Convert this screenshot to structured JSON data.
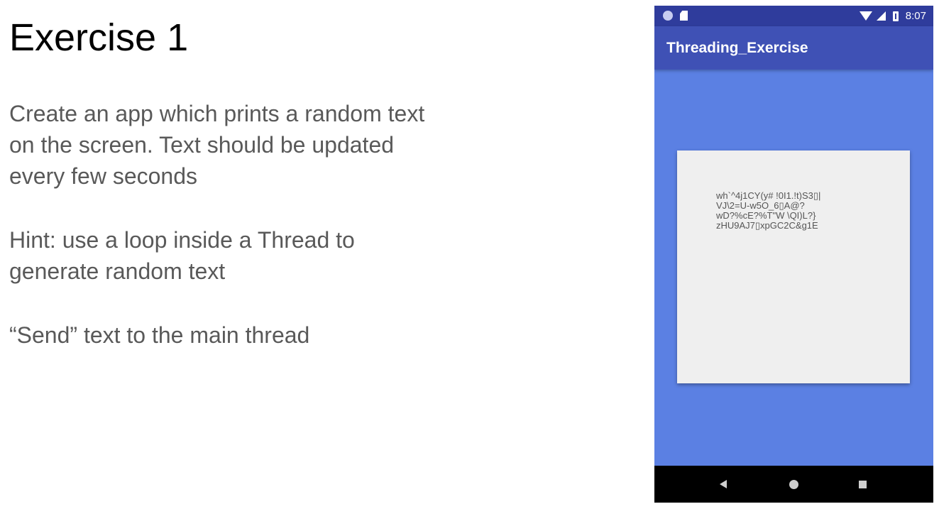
{
  "slide": {
    "title": "Exercise 1",
    "paragraphs": [
      "Create an app which prints a random text\non the screen. Text should be updated\nevery few seconds",
      "Hint: use a loop inside a Thread to\ngenerate random text",
      "“Send” text to the main thread"
    ]
  },
  "phone": {
    "status_bar": {
      "time": "8:07",
      "icons": [
        "notification-dot-icon",
        "sd-card-icon",
        "wifi-icon",
        "cell-signal-icon",
        "battery-icon"
      ]
    },
    "app_bar": {
      "title": "Threading_Exercise"
    },
    "card": {
      "random_text": "wh`^4j1CY(y# !0I1.!t)S3▯|\nVJ\\2=U-w5O_6▯A@?\nwD?%cE?%T\"W \\QI)L?}\nzHU9AJ7▯xpGC2C&g1E"
    },
    "nav_bar": {
      "icons": [
        "back-icon",
        "home-icon",
        "recents-icon"
      ]
    }
  },
  "colors": {
    "status_bar": "#2f3c9c",
    "app_bar": "#3f51b5",
    "screen_background": "#5b80e3",
    "card_background": "#efefef",
    "body_text": "#595959"
  }
}
